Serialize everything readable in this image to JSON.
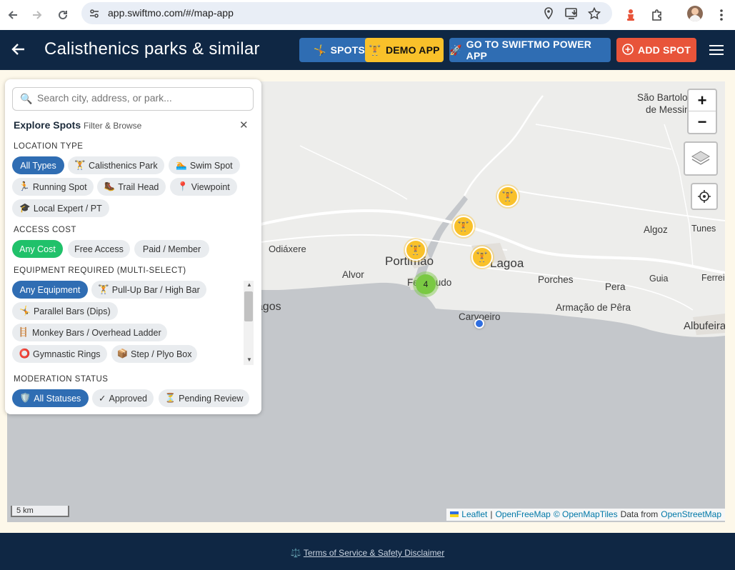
{
  "browser": {
    "url": "app.swiftmo.com/#/map-app"
  },
  "header": {
    "title": "Calisthenics parks & similar",
    "buttons": {
      "spots": "SPOTS",
      "demo": "DEMO APP",
      "power": "GO TO SWIFTMO POWER APP",
      "add": "ADD SPOT"
    }
  },
  "panel": {
    "search_placeholder": "Search city, address, or park...",
    "title": "Explore Spots",
    "subtitle": "Filter & Browse",
    "location_type": {
      "label": "LOCATION TYPE",
      "chips": [
        "All Types",
        "Calisthenics Park",
        "Swim Spot",
        "Running Spot",
        "Trail Head",
        "Viewpoint",
        "Local Expert / PT"
      ]
    },
    "access_cost": {
      "label": "ACCESS COST",
      "chips": [
        "Any Cost",
        "Free Access",
        "Paid / Member"
      ]
    },
    "equipment": {
      "label": "EQUIPMENT REQUIRED (MULTI-SELECT)",
      "chips": [
        "Any Equipment",
        "Pull-Up Bar / High Bar",
        "Parallel Bars (Dips)",
        "Monkey Bars / Overhead Ladder",
        "Gymnastic Rings",
        "Step / Plyo Box"
      ]
    },
    "moderation": {
      "label": "MODERATION STATUS",
      "chips": [
        "All Statuses",
        "Approved",
        "Pending Review"
      ]
    }
  },
  "map": {
    "places": [
      "São Bartolomeu",
      "de Messines",
      "Odiáxere",
      "Portimão",
      "Lagoa",
      "Alvor",
      "Ferragudo",
      "Lagos",
      "Carvoeiro",
      "Algoz",
      "Tunes",
      "Porches",
      "Guia",
      "Ferreira",
      "Pera",
      "Armação de Pêra",
      "Albufeira"
    ],
    "cluster_count": "4",
    "scale": "5 km",
    "attribution": {
      "leaflet": "Leaflet",
      "sep": "|",
      "ofm": "OpenFreeMap",
      "omt": "© OpenMapTiles",
      "data_from": "Data from",
      "osm": "OpenStreetMap"
    }
  },
  "footer": {
    "terms": "Terms of Service & Safety Disclaimer"
  },
  "colors": {
    "navy": "#0f2744",
    "blue": "#2f6db3",
    "yellow": "#f9c12a",
    "red": "#e8543a",
    "green": "#20c16a",
    "cluster": "#7ac943"
  }
}
